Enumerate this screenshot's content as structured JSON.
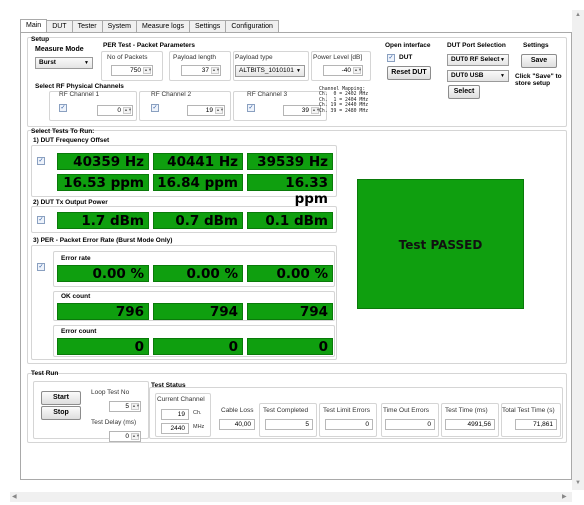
{
  "tabs": [
    "Main",
    "DUT",
    "Tester",
    "System",
    "Measure logs",
    "Settings",
    "Configuration"
  ],
  "setup": {
    "title": "Setup",
    "measure_mode_label": "Measure Mode",
    "measure_mode_value": "Burst",
    "per_title": "PER Test - Packet Parameters",
    "num_packets_label": "No of Packets",
    "num_packets_value": "750",
    "payload_length_label": "Payload length",
    "payload_length_value": "37",
    "payload_type_label": "Payload type",
    "payload_type_value": "ALTBITS_1010101",
    "power_level_label": "Power Level [dB]",
    "power_level_value": "-40",
    "open_interface_title": "Open interface",
    "dut_check_label": "DUT",
    "reset_dut_button": "Reset DUT",
    "dut_port_title": "DUT Port Selection",
    "rf_select_value": "DUT0 RF Select",
    "usb_value": "DUT0 USB",
    "select_button": "Select",
    "settings_title": "Settings",
    "save_button": "Save",
    "save_hint": "Click \"Save\" to store setup",
    "rf_channels_title": "Select RF Physical Channels",
    "ch1_label": "RF Channel 1",
    "ch1_value": "0",
    "ch2_label": "RF Channel 2",
    "ch2_value": "19",
    "ch3_label": "RF Channel 3",
    "ch3_value": "39",
    "channel_mapping": "Channel Mapping:\nCh.  0 = 2402 MHz\nCh.  1 = 2404 MHz\nCh. 19 = 2440 MHz\nCh. 39 = 2480 MHz"
  },
  "tests": {
    "title": "Select Tests To Run:",
    "freq_title": "1) DUT Frequency Offset",
    "freq_hz": [
      "40359 Hz",
      "40441 Hz",
      "39539 Hz"
    ],
    "freq_ppm": [
      "16.53 ppm",
      "16.84 ppm",
      "16.33 ppm"
    ],
    "power_title": "2) DUT Tx Output Power",
    "power_dbm": [
      "1.7 dBm",
      "0.7 dBm",
      "0.1 dBm"
    ],
    "per_title": "3) PER - Packet Error Rate (Burst Mode Only)",
    "error_rate_label": "Error rate",
    "error_rate": [
      "0.00 %",
      "0.00 %",
      "0.00 %"
    ],
    "ok_count_label": "OK count",
    "ok_count": [
      "796",
      "794",
      "794"
    ],
    "error_count_label": "Error count",
    "error_count": [
      "0",
      "0",
      "0"
    ],
    "result_text": "Test PASSED"
  },
  "run": {
    "title": "Test Run",
    "start_button": "Start",
    "stop_button": "Stop",
    "loop_label": "Loop Test No",
    "loop_value": "5",
    "delay_label": "Test Delay (ms)",
    "delay_value": "0",
    "status_title": "Test Status",
    "current_channel_label": "Current Channel",
    "current_ch_value": "19",
    "current_ch_unit": "Ch.",
    "current_mhz_value": "2440",
    "current_mhz_unit": "MHz",
    "cable_loss_label": "Cable Loss",
    "cable_loss_value": "40,00",
    "completed_label": "Test Completed",
    "completed_value": "5",
    "limit_errors_label": "Test Limit Errors",
    "limit_errors_value": "0",
    "timeout_label": "Time Out Errors",
    "timeout_value": "0",
    "test_time_label": "Test Time (ms)",
    "test_time_value": "4991,56",
    "total_time_label": "Total Test Time (s)",
    "total_time_value": "71,861"
  }
}
